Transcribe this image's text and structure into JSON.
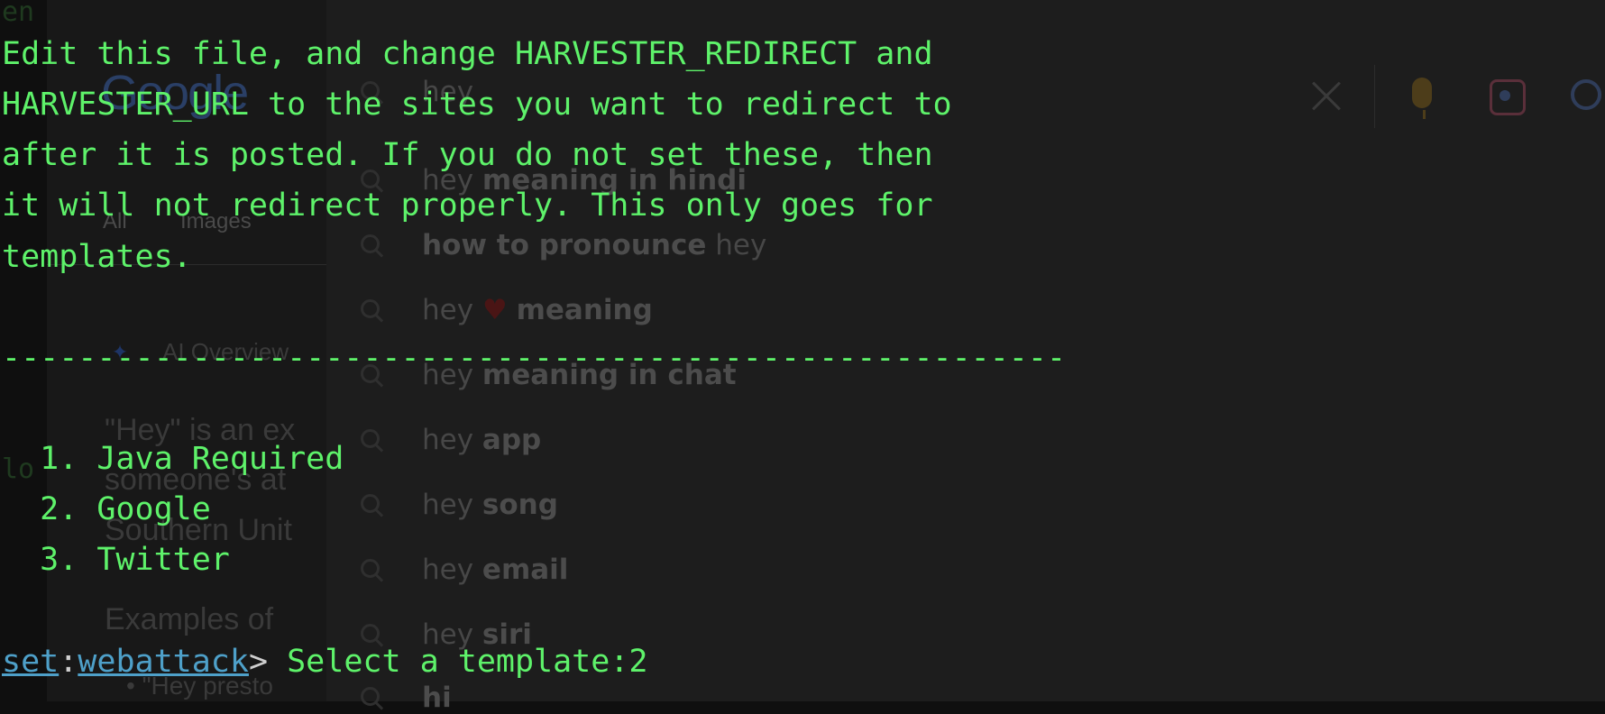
{
  "terminal": {
    "paragraph": [
      "Edit this file, and change HARVESTER_REDIRECT and",
      "HARVESTER_URL to the sites you want to redirect to",
      "after it is posted. If you do not set these, then",
      "it will not redirect properly. This only goes for",
      "templates."
    ],
    "divider": "--------------------------------------------------------",
    "menu": [
      "  1. Java Required",
      "  2. Google",
      "  3. Twitter"
    ],
    "prompt": {
      "set": "set",
      "colon": ":",
      "module": "webattack",
      "gt": ">",
      "question": " Select a template:",
      "input": "2"
    },
    "fragments": {
      "top": "en",
      "mid": "lo"
    }
  },
  "background": {
    "logo": "Google",
    "tabs": [
      "All",
      "Images"
    ],
    "ai_label": "AI Overview",
    "body_lines": [
      "\"Hey\" is an ex",
      "someone's at",
      "Southern Unit",
      "Examples of",
      "•  \"Hey presto"
    ],
    "suggestions": [
      {
        "plain": "hey",
        "bold": ""
      },
      {
        "plain": "hey ",
        "bold": "meaning in hindi"
      },
      {
        "plain": " hey",
        "bold": "how to pronounce"
      },
      {
        "plain": "hey ",
        "bold": "meaning"
      },
      {
        "plain": "hey ",
        "bold": "meaning in chat"
      },
      {
        "plain": "hey ",
        "bold": "app"
      },
      {
        "plain": "hey ",
        "bold": "song"
      },
      {
        "plain": "hey ",
        "bold": "email"
      },
      {
        "plain": "hey ",
        "bold": "siri"
      },
      {
        "plain": "",
        "bold": "hi"
      }
    ]
  },
  "colors": {
    "terminal_text": "#5ef26a",
    "prompt_link": "#4ea0c9",
    "background": "#0f0f0f"
  }
}
